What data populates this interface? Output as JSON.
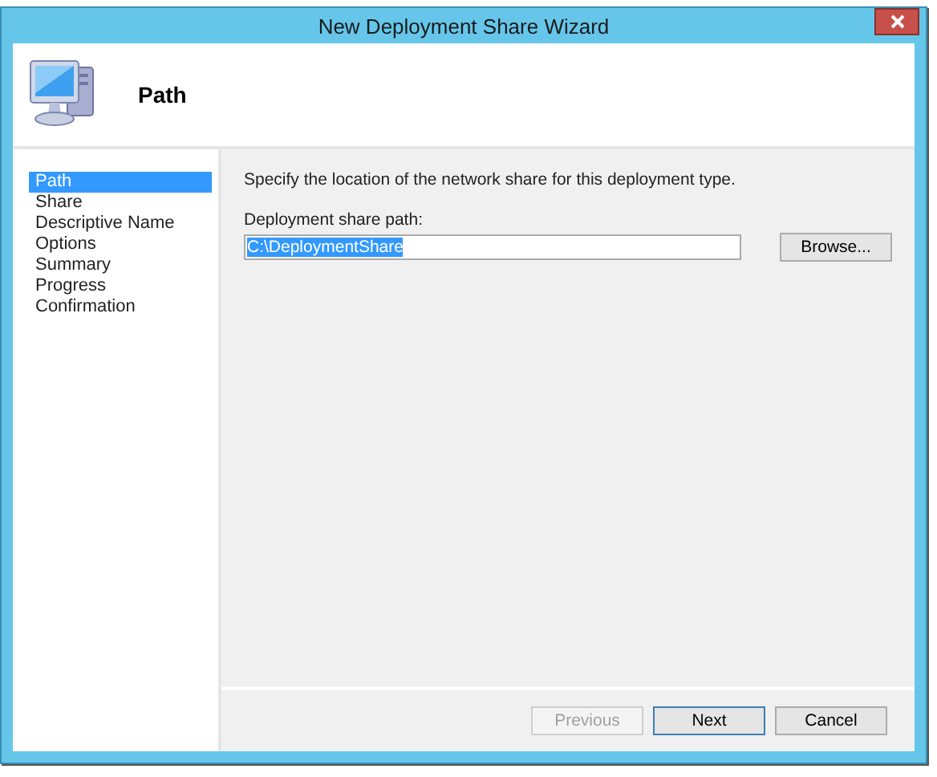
{
  "window": {
    "title": "New Deployment Share Wizard"
  },
  "header": {
    "title": "Path"
  },
  "steps": [
    {
      "label": "Path",
      "selected": true
    },
    {
      "label": "Share",
      "selected": false
    },
    {
      "label": "Descriptive Name",
      "selected": false
    },
    {
      "label": "Options",
      "selected": false
    },
    {
      "label": "Summary",
      "selected": false
    },
    {
      "label": "Progress",
      "selected": false
    },
    {
      "label": "Confirmation",
      "selected": false
    }
  ],
  "instruction": "Specify the location of the network share for this deployment type.",
  "path_field": {
    "label": "Deployment share path:",
    "value": "C:\\DeploymentShare",
    "text_selected": true
  },
  "browse_button": "Browse...",
  "buttons": [
    {
      "label": "Previous",
      "disabled": true,
      "default": false
    },
    {
      "label": "Next",
      "disabled": false,
      "default": true
    },
    {
      "label": "Cancel",
      "disabled": false,
      "default": false
    }
  ]
}
